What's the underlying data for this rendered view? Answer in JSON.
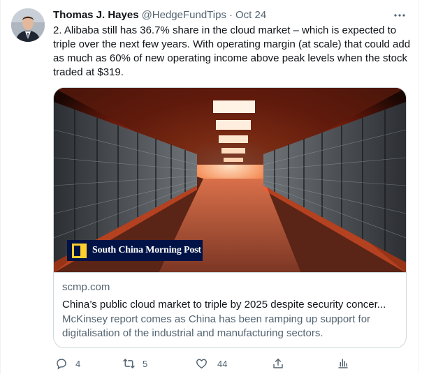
{
  "tweet": {
    "author_name": "Thomas J. Hayes",
    "handle": "@HedgeFundTips",
    "separator": "·",
    "date": "Oct 24",
    "text": "2. Alibaba still has 36.7% share in the cloud market – which is expected to triple over the next few years.  With operating margin (at scale) that could add as much as 60% of new operating income above peak levels when the stock traded at $319."
  },
  "card": {
    "brand": "South China Morning Post",
    "domain": "scmp.com",
    "title": "China’s public cloud market to triple by 2025 despite security concer...",
    "description": "McKinsey report comes as China has been ramping up support for digitalisation of the industrial and manufacturing sectors."
  },
  "actions": {
    "reply_count": "4",
    "retweet_count": "5",
    "like_count": "44"
  },
  "icons": [
    "more-icon",
    "reply-icon",
    "retweet-icon",
    "like-icon",
    "share-icon",
    "analytics-icon"
  ],
  "colors": {
    "text_primary": "#0f1419",
    "text_secondary": "#536471",
    "border": "#cfd9de",
    "brand_navy": "#001246",
    "brand_yellow": "#ffcf2e"
  }
}
